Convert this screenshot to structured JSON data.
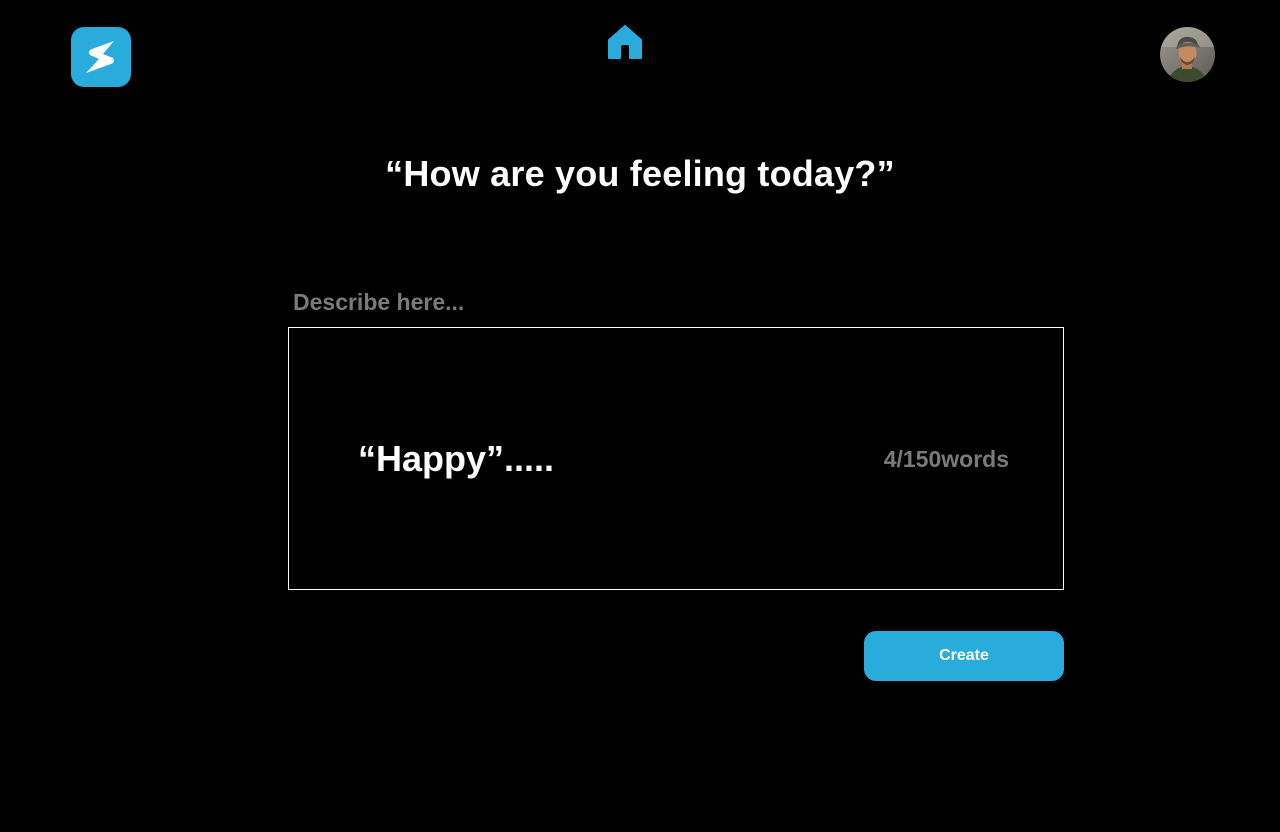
{
  "header": {
    "logo_icon": "lightning-s-logo-icon",
    "home_icon": "home-icon",
    "avatar_icon": "user-avatar",
    "accent_color": "#29abdb"
  },
  "main": {
    "title": "“How are you feeling today?”",
    "input_label": "Describe here...",
    "input_value": "“Happy”.....",
    "word_counter": "4/150words",
    "create_label": "Create"
  }
}
